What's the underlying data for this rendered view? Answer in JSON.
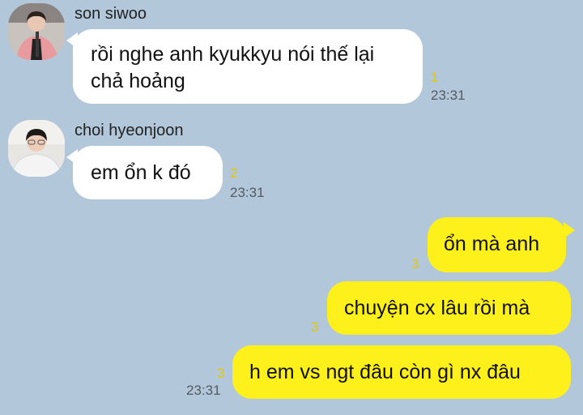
{
  "messages": [
    {
      "sender": "son siwoo",
      "avatar_icon": "user-avatar-icon",
      "lines": [
        "rồi nghe anh kyukkyu nói thế lại",
        "chả hoảng"
      ],
      "unread": "1",
      "time": "23:31"
    },
    {
      "sender": "choi hyeonjoon",
      "avatar_icon": "user-avatar-icon",
      "text": "em ổn k đó",
      "unread": "2",
      "time": "23:31"
    },
    {
      "text": "ổn mà anh",
      "unread": "3"
    },
    {
      "text": "chuyện cx lâu rồi mà",
      "unread": "3"
    },
    {
      "text": "h em vs ngt đâu còn gì nx đâu",
      "unread": "3",
      "time": "23:31"
    }
  ],
  "colors": {
    "background": "#b2c7da",
    "incoming_bubble": "#ffffff",
    "outgoing_bubble": "#fef01b",
    "unread_count": "#e6c800",
    "timestamp": "#555a60"
  }
}
